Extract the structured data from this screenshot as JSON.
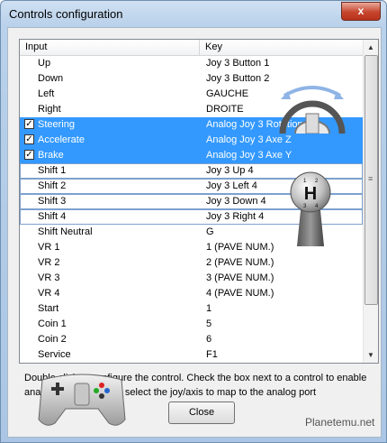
{
  "window": {
    "title": "Controls configuration",
    "close_glyph": "x"
  },
  "list": {
    "headers": {
      "input": "Input",
      "key": "Key"
    },
    "rows": [
      {
        "input": "Up",
        "key": "Joy 3 Button 1",
        "checkbox": false,
        "checked": false,
        "selected": false,
        "boxed": false
      },
      {
        "input": "Down",
        "key": "Joy 3 Button 2",
        "checkbox": false,
        "checked": false,
        "selected": false,
        "boxed": false
      },
      {
        "input": "Left",
        "key": "GAUCHE",
        "checkbox": false,
        "checked": false,
        "selected": false,
        "boxed": false
      },
      {
        "input": "Right",
        "key": "DROITE",
        "checkbox": false,
        "checked": false,
        "selected": false,
        "boxed": false
      },
      {
        "input": "Steering",
        "key": "Analog Joy 3 Rotation Z",
        "checkbox": true,
        "checked": true,
        "selected": true,
        "boxed": false
      },
      {
        "input": "Accelerate",
        "key": "Analog Joy 3 Axe Z",
        "checkbox": true,
        "checked": true,
        "selected": true,
        "boxed": false
      },
      {
        "input": "Brake",
        "key": "Analog Joy 3 Axe Y",
        "checkbox": true,
        "checked": true,
        "selected": true,
        "boxed": false
      },
      {
        "input": "Shift 1",
        "key": "Joy 3 Up 4",
        "checkbox": false,
        "checked": false,
        "selected": false,
        "boxed": true
      },
      {
        "input": "Shift 2",
        "key": "Joy 3 Left 4",
        "checkbox": false,
        "checked": false,
        "selected": false,
        "boxed": true
      },
      {
        "input": "Shift 3",
        "key": "Joy 3 Down 4",
        "checkbox": false,
        "checked": false,
        "selected": false,
        "boxed": true
      },
      {
        "input": "Shift 4",
        "key": "Joy 3 Right 4",
        "checkbox": false,
        "checked": false,
        "selected": false,
        "boxed": true
      },
      {
        "input": "Shift Neutral",
        "key": "G",
        "checkbox": false,
        "checked": false,
        "selected": false,
        "boxed": false
      },
      {
        "input": "VR 1",
        "key": "1 (PAVE NUM.)",
        "checkbox": false,
        "checked": false,
        "selected": false,
        "boxed": false
      },
      {
        "input": "VR 2",
        "key": "2 (PAVE NUM.)",
        "checkbox": false,
        "checked": false,
        "selected": false,
        "boxed": false
      },
      {
        "input": "VR 3",
        "key": "3 (PAVE NUM.)",
        "checkbox": false,
        "checked": false,
        "selected": false,
        "boxed": false
      },
      {
        "input": "VR 4",
        "key": "4 (PAVE NUM.)",
        "checkbox": false,
        "checked": false,
        "selected": false,
        "boxed": false
      },
      {
        "input": "Start",
        "key": "1",
        "checkbox": false,
        "checked": false,
        "selected": false,
        "boxed": false
      },
      {
        "input": "Coin 1",
        "key": "5",
        "checkbox": false,
        "checked": false,
        "selected": false,
        "boxed": false
      },
      {
        "input": "Coin 2",
        "key": "6",
        "checkbox": false,
        "checked": false,
        "selected": false,
        "boxed": false
      },
      {
        "input": "Service",
        "key": "F1",
        "checkbox": false,
        "checked": false,
        "selected": false,
        "boxed": false
      }
    ]
  },
  "help_text": "Double click to configure the control. Check the box next to a control to enable analog, double click to select the joy/axis to map to the analog port",
  "close_button": "Close",
  "watermark": "Planetemu.net",
  "gear_letter": "H",
  "gear_numbers": [
    "1",
    "2",
    "3",
    "4"
  ],
  "colors": {
    "selection": "#3399ff",
    "titlebar": "#b9d1ea",
    "close_red": "#c7452d"
  },
  "icons": [
    "close-icon",
    "steering-wheel-icon",
    "gear-shifter-icon",
    "gamepad-icon",
    "scroll-up-icon",
    "scroll-down-icon"
  ]
}
